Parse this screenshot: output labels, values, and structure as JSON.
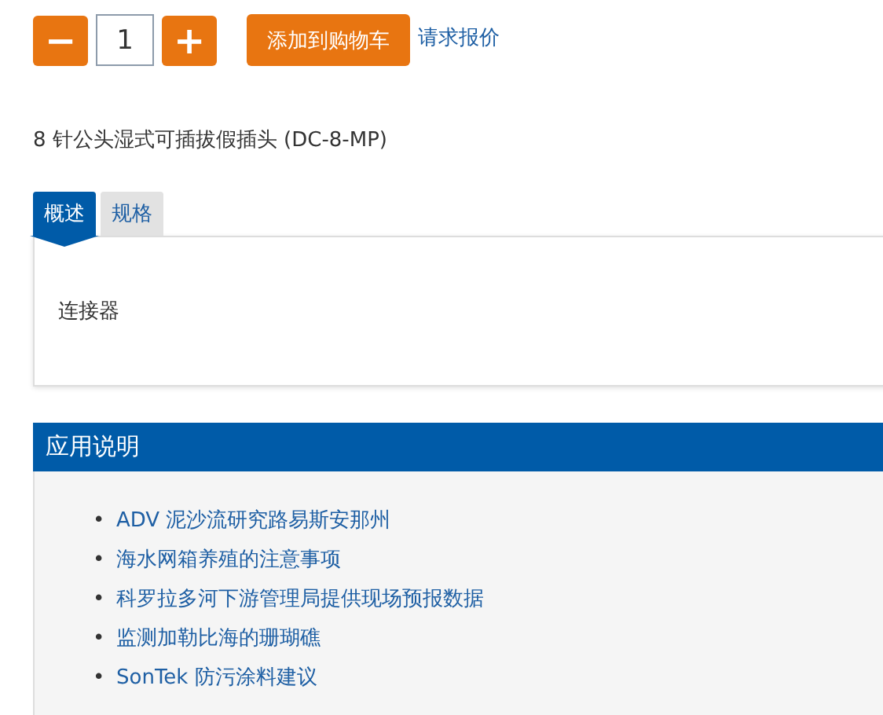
{
  "quantity": {
    "decrease": "−",
    "value": "1",
    "increase": "+"
  },
  "add_to_cart": "添加到购物车",
  "request_quote": "请求报价",
  "product_title": "8 针公头湿式可插拔假插头 (DC-8-MP)",
  "tabs": [
    {
      "label": "概述",
      "selected": true
    },
    {
      "label": "规格",
      "selected": false
    }
  ],
  "tab_content": "连接器",
  "application_notes": {
    "title": "应用说明",
    "items": [
      {
        "bullet": "•",
        "text": "ADV 泥沙流研究路易斯安那州"
      },
      {
        "bullet": "•",
        "text": "海水网箱养殖的注意事项"
      },
      {
        "bullet": "•",
        "text": "科罗拉多河下游管理局提供现场预报数据"
      },
      {
        "bullet": "•",
        "text": "监测加勒比海的珊瑚礁"
      },
      {
        "bullet": "•",
        "text": "SonTek 防污涂料建议"
      }
    ]
  }
}
